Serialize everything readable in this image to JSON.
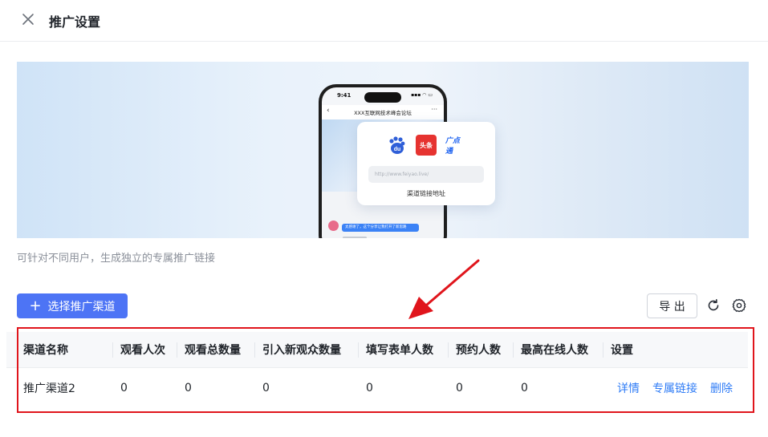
{
  "header": {
    "title": "推广设置"
  },
  "banner": {
    "phone_time": "9:41",
    "phone_status": "▪▪▪ ◠ ▭",
    "phone_title": "XXX互联网技术峰会论坛",
    "phone_chat_message": "太感谢了，这个分享让我打开了新思路",
    "popup_logos": [
      "du",
      "头条",
      "广点通"
    ],
    "popup_url_placeholder": "http://www.feiyao.live/",
    "popup_label": "渠道链接地址"
  },
  "hint": "可针对不同用户，生成独立的专属推广链接",
  "toolbar": {
    "select_channel_label": "选择推广渠道",
    "export_label": "导 出"
  },
  "table": {
    "columns": [
      "渠道名称",
      "观看人次",
      "观看总数量",
      "引入新观众数量",
      "填写表单人数",
      "预约人数",
      "最高在线人数",
      "设置"
    ],
    "rows": [
      {
        "name": "推广渠道2",
        "views": "0",
        "total_views": "0",
        "new_viewers": "0",
        "form_fills": "0",
        "reservations": "0",
        "peak_online": "0",
        "actions": [
          "详情",
          "专属链接",
          "删除"
        ]
      }
    ]
  },
  "colors": {
    "primary": "#4d74f5",
    "link": "#2f7cf6",
    "annotation_red": "#e0151c"
  }
}
